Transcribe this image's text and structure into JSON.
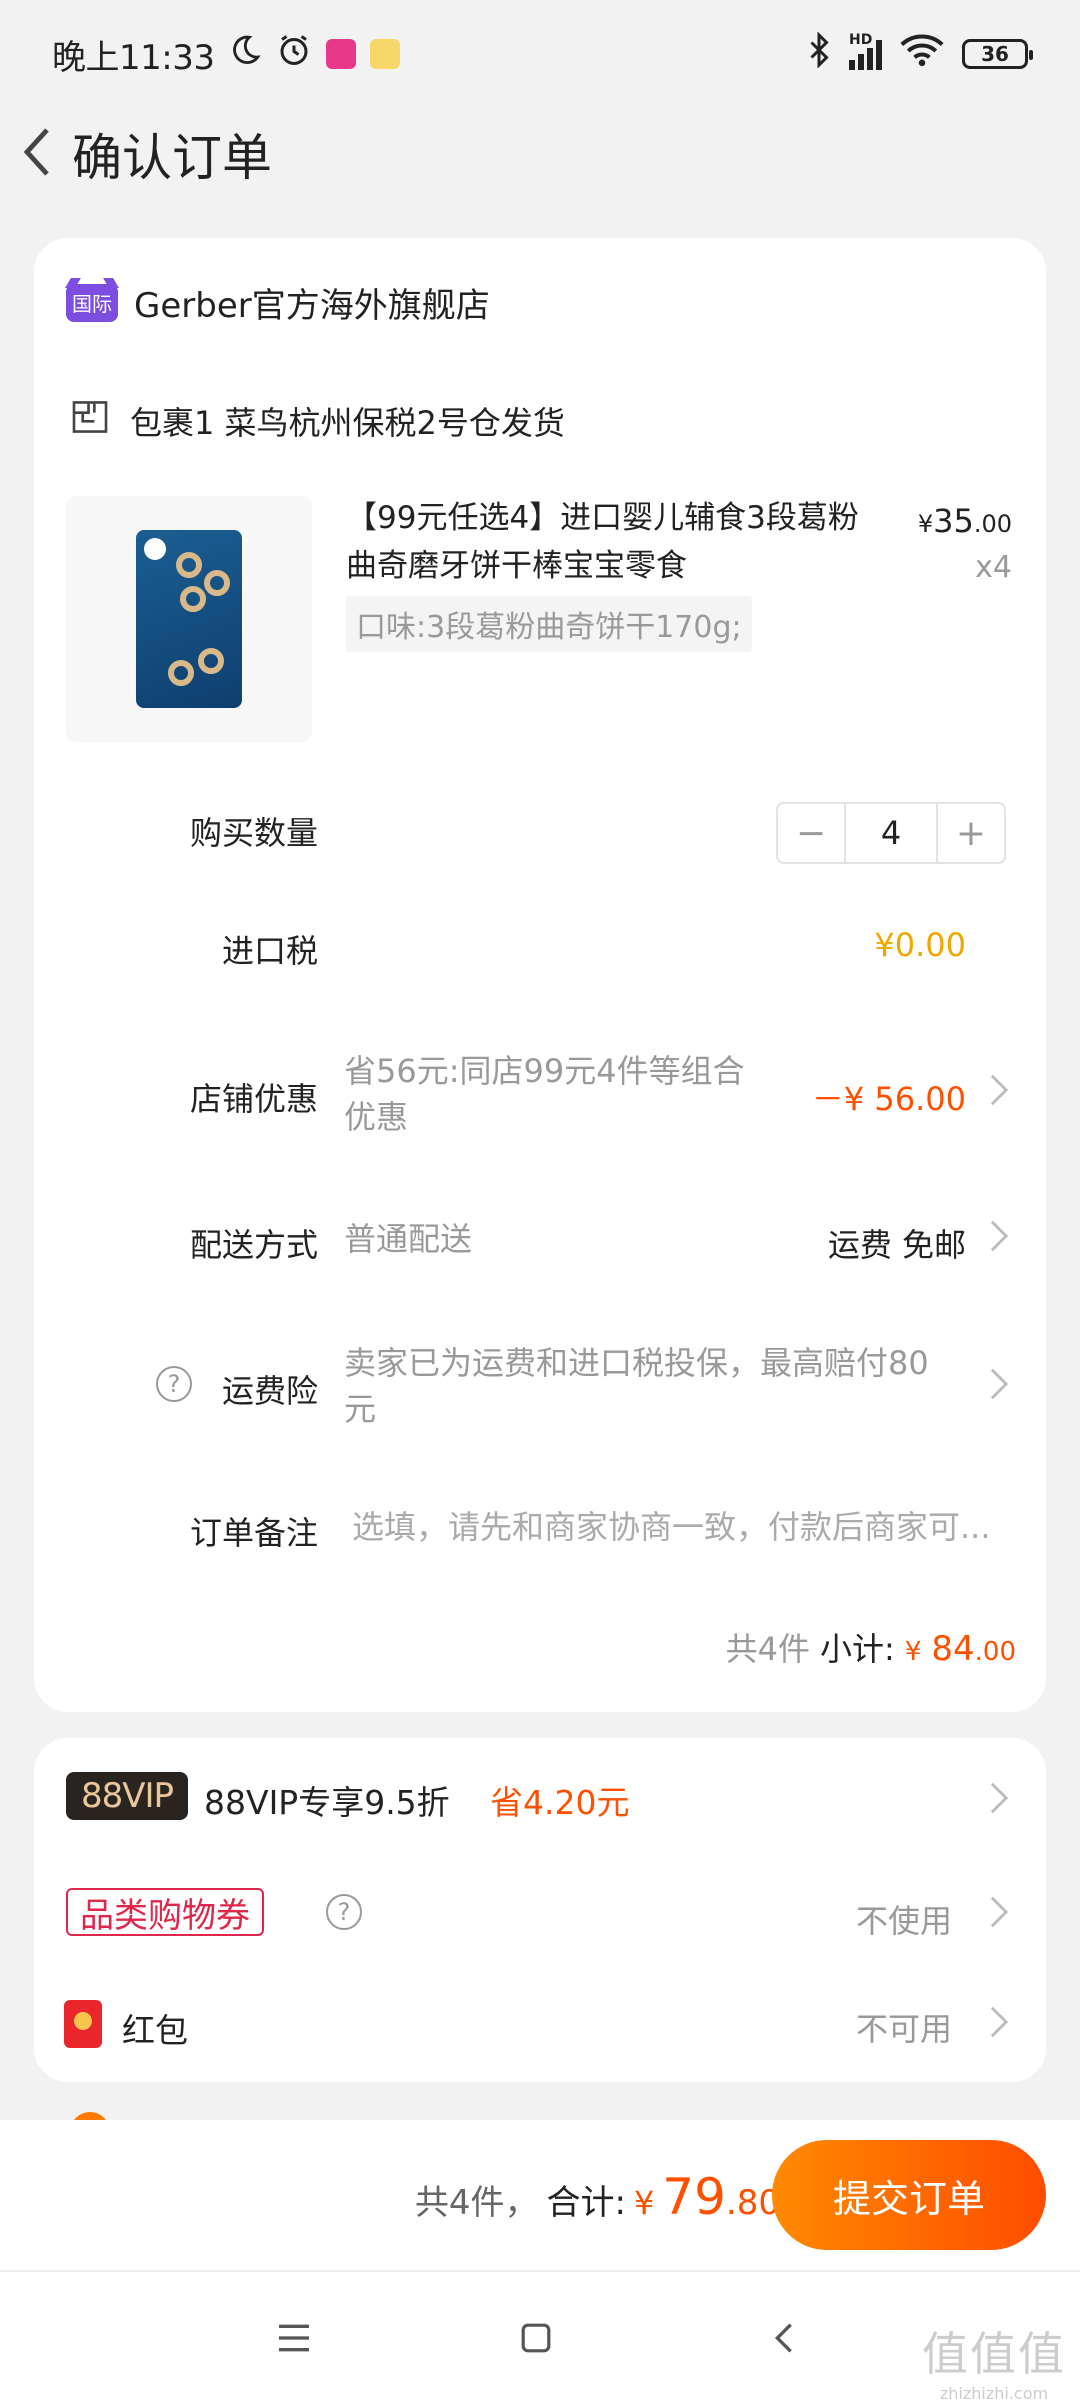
{
  "status_bar": {
    "time": "晚上11:33",
    "battery": "36",
    "network": "HD"
  },
  "header": {
    "title": "确认订单"
  },
  "order": {
    "store_badge": "国际",
    "store_name": "Gerber官方海外旗舰店",
    "package_label": "包裹1 菜鸟杭州保税2号仓发货",
    "product": {
      "title": "【99元任选4】进口婴儿辅食3段葛粉曲奇磨牙饼干棒宝宝零食",
      "price_currency": "¥",
      "price_int": "35",
      "price_dec": ".00",
      "qty": "x4",
      "spec": "口味:3段葛粉曲奇饼干170g;"
    },
    "quantity": {
      "label": "购买数量",
      "minus": "−",
      "value": "4",
      "plus": "+"
    },
    "import_tax": {
      "label": "进口税",
      "value": "¥0.00"
    },
    "store_discount": {
      "label": "店铺优惠",
      "desc": "省56元:同店99元4件等组合优惠",
      "value": "－¥ 56.00"
    },
    "delivery": {
      "label": "配送方式",
      "desc": "普通配送",
      "value": "运费 免邮"
    },
    "shipping_insurance": {
      "label": "运费险",
      "desc": "卖家已为运费和进口税投保，最高赔付80元"
    },
    "note": {
      "label": "订单备注",
      "placeholder": "选填，请先和商家协商一致，付款后商家可..."
    },
    "subtotal": {
      "count": "共4件",
      "label": "小计:",
      "currency": "¥",
      "int": "84",
      "dec": ".00"
    }
  },
  "benefits": {
    "vip": {
      "badge": "88VIP",
      "label": "88VIP专享9.5折",
      "save": "省4.20元"
    },
    "coupon": {
      "badge": "品类购物券",
      "value": "不使用"
    },
    "redpack": {
      "label": "红包",
      "value": "不可用"
    }
  },
  "footer": {
    "count": "共4件，",
    "label": "合计:",
    "currency": "¥",
    "int": "79",
    "dec": ".80",
    "submit": "提交订单"
  },
  "watermark": {
    "big": "值值值",
    "small": "zhizhizhi.com"
  },
  "colors": {
    "accent": "#ff5000",
    "tax": "#f0a800",
    "vip_gold": "#e9c79a",
    "coupon_red": "#e0264b"
  }
}
